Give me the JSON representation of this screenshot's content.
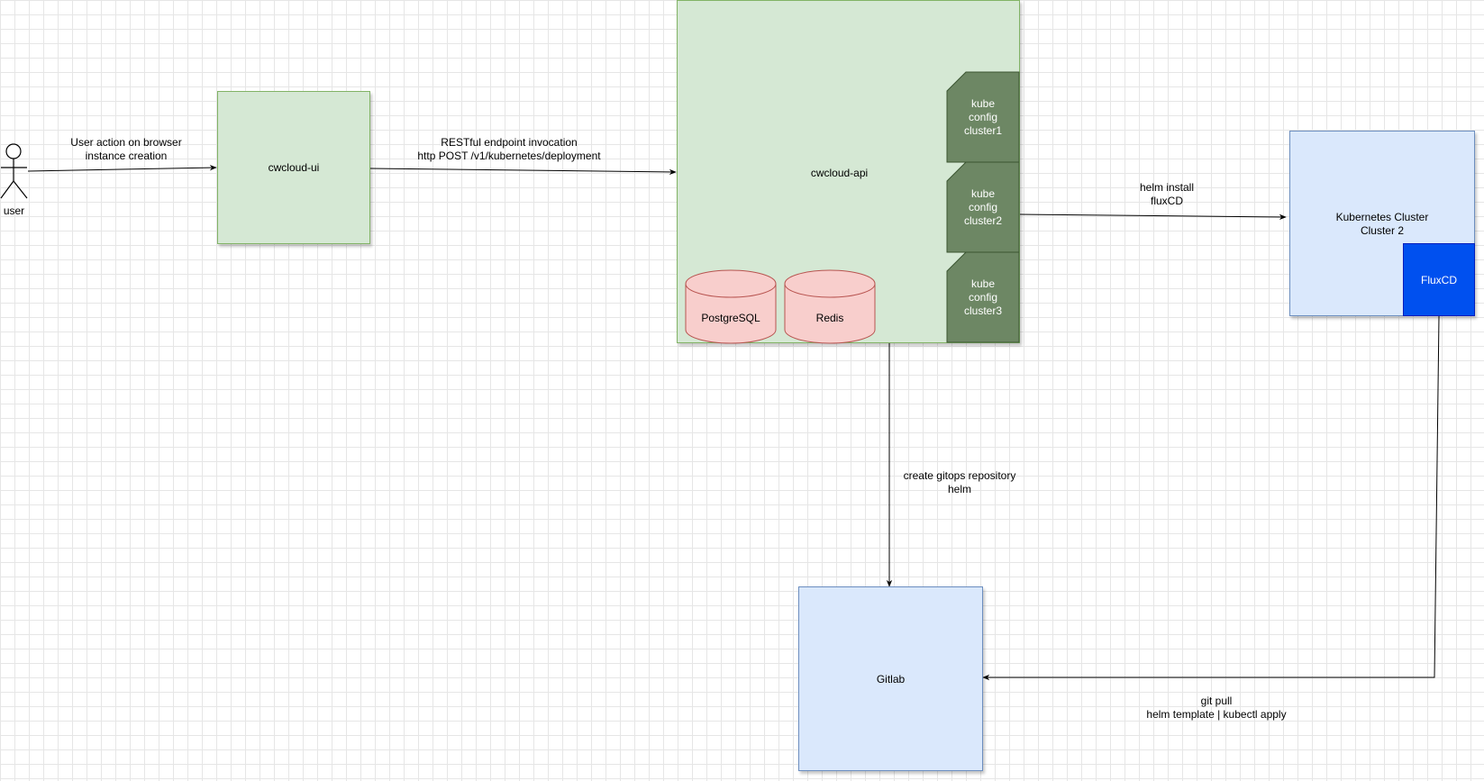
{
  "actor": {
    "label": "user"
  },
  "nodes": {
    "ui": "cwcloud-ui",
    "api": "cwcloud-api",
    "k8s_line1": "Kubernetes Cluster",
    "k8s_line2": "Cluster 2",
    "fluxcd": "FluxCD",
    "gitlab": "Gitlab"
  },
  "kubeconfigs": [
    {
      "line1": "kube",
      "line2": "config",
      "line3": "cluster1"
    },
    {
      "line1": "kube",
      "line2": "config",
      "line3": "cluster2"
    },
    {
      "line1": "kube",
      "line2": "config",
      "line3": "cluster3"
    }
  ],
  "databases": [
    "PostgreSQL",
    "Redis"
  ],
  "edges": {
    "user_to_ui": [
      "User action on browser",
      "instance creation"
    ],
    "ui_to_api": [
      "RESTful endpoint invocation",
      "http POST /v1/kubernetes/deployment"
    ],
    "api_to_k8s": [
      "helm install",
      "fluxCD"
    ],
    "api_to_gitlab": [
      "create gitops repository",
      "helm"
    ],
    "flux_to_gitlab": [
      "git pull",
      "helm template | kubectl apply"
    ]
  },
  "colors": {
    "green_fill": "#d5e8d4",
    "green_stroke": "#82b366",
    "kube_fill": "#6d8764",
    "blue_fill": "#dae8fc",
    "blue_stroke": "#6c8ebf",
    "flux_fill": "#0050ef",
    "db_fill": "#f8cecc",
    "db_stroke": "#b85450"
  }
}
